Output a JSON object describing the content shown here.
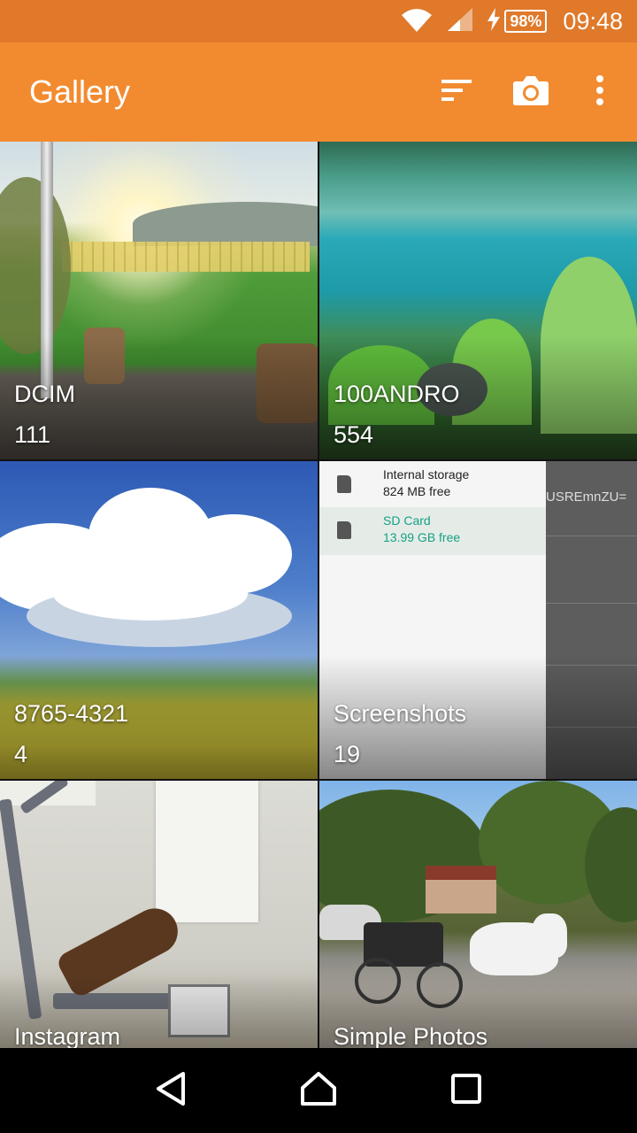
{
  "status_bar": {
    "battery": "98%",
    "time": "09:48",
    "icons": [
      "wifi-icon",
      "signal-icon",
      "charging-icon",
      "battery-icon"
    ]
  },
  "app_bar": {
    "title": "Gallery",
    "actions": [
      "sort-icon",
      "camera-icon",
      "more-vert-icon"
    ],
    "colors": {
      "app_bar": "#f28b30",
      "status_bar": "#e0792a"
    }
  },
  "folders": [
    {
      "name": "DCIM",
      "count": "111"
    },
    {
      "name": "100ANDRO",
      "count": "554"
    },
    {
      "name": "8765-4321",
      "count": "4"
    },
    {
      "name": "Screenshots",
      "count": "19"
    },
    {
      "name": "Instagram",
      "count": ""
    },
    {
      "name": "Simple Photos",
      "count": ""
    }
  ],
  "screenshot_thumb": {
    "items": [
      {
        "title": "Internal storage",
        "subtitle": "824 MB free"
      },
      {
        "title": "SD Card",
        "subtitle": "13.99 GB free"
      }
    ],
    "side_text": "USREmnZU="
  },
  "nav_bar": {
    "buttons": [
      "back-icon",
      "home-icon",
      "recents-icon"
    ]
  }
}
